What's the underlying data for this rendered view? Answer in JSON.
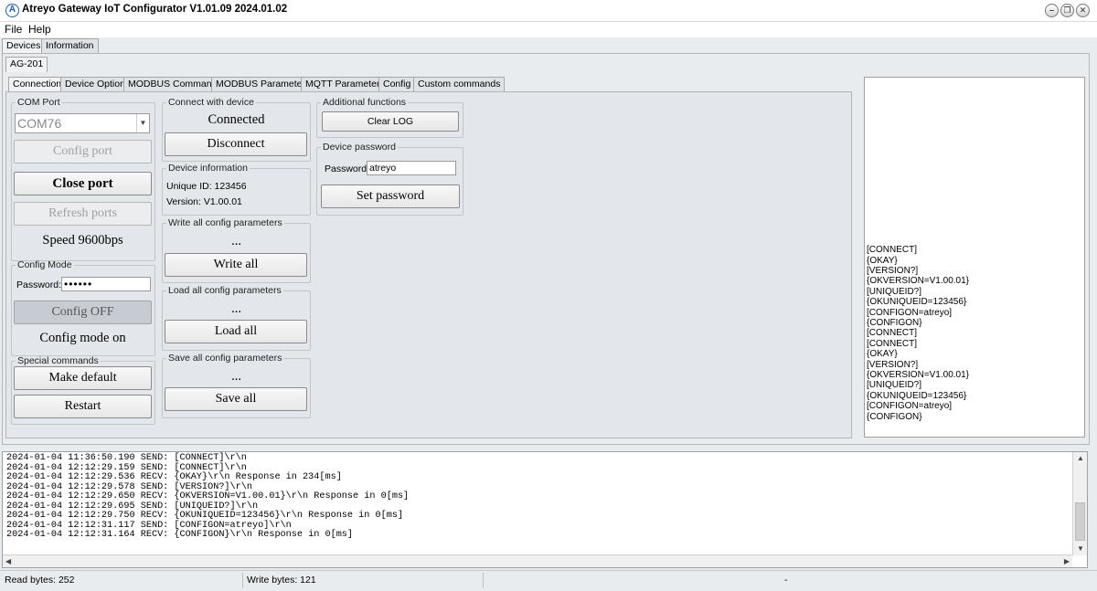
{
  "window": {
    "title": "Atreyo Gateway  IoT Configurator V1.01.09 2024.01.02"
  },
  "menu": {
    "file": "File",
    "help": "Help"
  },
  "top_tabs": {
    "devices": "Devices",
    "information": "Information"
  },
  "device_tab": "AG-201",
  "sub_tabs": [
    "Connection",
    "Device Option",
    "MODBUS Commands",
    "MODBUS Parameters",
    "MQTT Parameters",
    "Config",
    "Custom commands"
  ],
  "com_port": {
    "legend": "COM Port",
    "selected": "COM76",
    "config_port": "Config port",
    "close_port": "Close port",
    "refresh_ports": "Refresh ports",
    "speed": "Speed 9600bps"
  },
  "config_mode": {
    "legend": "Config Mode",
    "password_label": "Password:",
    "password_value": "••••••",
    "config_off": "Config OFF",
    "status": "Config mode on"
  },
  "special": {
    "legend": "Special commands",
    "make_default": "Make default",
    "restart": "Restart"
  },
  "connect": {
    "legend": "Connect with device",
    "status": "Connected",
    "disconnect": "Disconnect"
  },
  "device_info": {
    "legend": "Device information",
    "unique_id": "Unique ID: 123456",
    "version": "Version: V1.00.01"
  },
  "write_all": {
    "legend": "Write all config parameters",
    "status": "...",
    "button": "Write all"
  },
  "load_all": {
    "legend": "Load all config parameters",
    "status": "...",
    "button": "Load all"
  },
  "save_all": {
    "legend": "Save all config parameters",
    "status": "...",
    "button": "Save all"
  },
  "additional": {
    "legend": "Additional functions",
    "clear_log": "Clear LOG"
  },
  "device_password": {
    "legend": "Device password",
    "password_label": "Password:",
    "password_value": "atreyo",
    "set_password": "Set password"
  },
  "right_log": "[CONNECT]\n{OKAY}\n[VERSION?]\n{OKVERSION=V1.00.01}\n[UNIQUEID?]\n{OKUNIQUEID=123456}\n[CONFIGON=atreyo]\n{CONFIGON}\n[CONNECT]\n[CONNECT]\n{OKAY}\n[VERSION?]\n{OKVERSION=V1.00.01}\n[UNIQUEID?]\n{OKUNIQUEID=123456}\n[CONFIGON=atreyo]\n{CONFIGON}",
  "bottom_log": "2024-01-04 11:36:50.190 SEND: [CONNECT]\\r\\n\n2024-01-04 12:12:29.159 SEND: [CONNECT]\\r\\n\n2024-01-04 12:12:29.536 RECV: {OKAY}\\r\\n Response in 234[ms]\n2024-01-04 12:12:29.578 SEND: [VERSION?]\\r\\n\n2024-01-04 12:12:29.650 RECV: {OKVERSION=V1.00.01}\\r\\n Response in 0[ms]\n2024-01-04 12:12:29.695 SEND: [UNIQUEID?]\\r\\n\n2024-01-04 12:12:29.750 RECV: {OKUNIQUEID=123456}\\r\\n Response in 0[ms]\n2024-01-04 12:12:31.117 SEND: [CONFIGON=atreyo]\\r\\n\n2024-01-04 12:12:31.164 RECV: {CONFIGON}\\r\\n Response in 0[ms]",
  "status": {
    "read_bytes": "Read bytes: 252",
    "write_bytes": "Write bytes: 121",
    "extra": "-"
  }
}
